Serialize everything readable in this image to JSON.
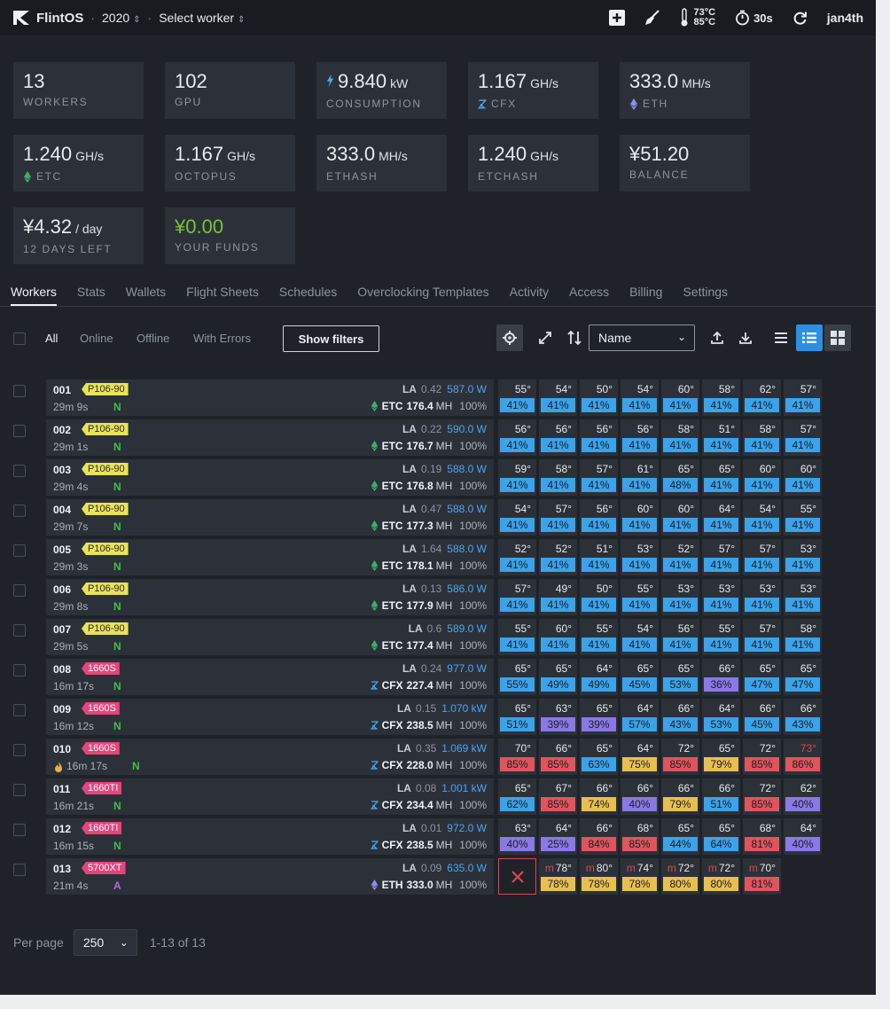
{
  "topbar": {
    "brand": "FlintOS",
    "farm": "2020",
    "worker_select": "Select worker",
    "temp_low": "73°C",
    "temp_high": "85°C",
    "timer": "30s",
    "user": "jan4th"
  },
  "stats": [
    [
      {
        "value": "13",
        "unit": "",
        "label": "WORKERS",
        "icon": ""
      },
      {
        "value": "102",
        "unit": "",
        "label": "GPU",
        "icon": ""
      },
      {
        "value": "9.840",
        "unit": "kW",
        "label": "CONSUMPTION",
        "icon": "lightning-icon"
      },
      {
        "value": "1.167",
        "unit": "GH/s",
        "label": "CFX",
        "icon": "cfx-icon"
      },
      {
        "value": "333.0",
        "unit": "MH/s",
        "label": "ETH",
        "icon": "eth-icon"
      }
    ],
    [
      {
        "value": "1.240",
        "unit": "GH/s",
        "label": "ETC",
        "icon": "etc-icon"
      },
      {
        "value": "1.167",
        "unit": "GH/s",
        "label": "OCTOPUS",
        "icon": ""
      },
      {
        "value": "333.0",
        "unit": "MH/s",
        "label": "ETHASH",
        "icon": ""
      },
      {
        "value": "1.240",
        "unit": "GH/s",
        "label": "ETCHASH",
        "icon": ""
      },
      {
        "value": "¥51.20",
        "unit": "",
        "label": "BALANCE",
        "icon": ""
      }
    ],
    [
      {
        "value": "¥4.32",
        "unit": "/ day",
        "label": "12 DAYS LEFT",
        "icon": ""
      },
      {
        "value": "¥0.00",
        "unit": "",
        "label": "YOUR FUNDS",
        "icon": "",
        "green": true
      }
    ]
  ],
  "tabs": [
    "Workers",
    "Stats",
    "Wallets",
    "Flight Sheets",
    "Schedules",
    "Overclocking Templates",
    "Activity",
    "Access",
    "Billing",
    "Settings"
  ],
  "filters": [
    "All",
    "Online",
    "Offline",
    "With Errors"
  ],
  "show_filters": "Show filters",
  "sort_select": "Name",
  "fan_colors": {
    "blue": "#3aa3ea",
    "purple": "#8a78e6",
    "red": "#e0545e",
    "yellow": "#e8c050"
  },
  "tag_colors": {
    "P106-90": "#e9e25a",
    "1660S": "#e8447c",
    "1660TI": "#e8447c",
    "5700XT": "#e8447c"
  },
  "workers": [
    {
      "id": "001",
      "tag": "P106-90",
      "uptime": "29m 9s",
      "net": "N",
      "la": "0.42",
      "power": "587.0 W",
      "coin": "ETC",
      "hashrate": "176.4",
      "unit": "MH",
      "share": "100%",
      "gpus": [
        [
          "55°",
          "41%",
          "blue"
        ],
        [
          "54°",
          "41%",
          "blue"
        ],
        [
          "50°",
          "41%",
          "blue"
        ],
        [
          "54°",
          "41%",
          "blue"
        ],
        [
          "60°",
          "41%",
          "blue"
        ],
        [
          "58°",
          "41%",
          "blue"
        ],
        [
          "62°",
          "41%",
          "blue"
        ],
        [
          "57°",
          "41%",
          "blue"
        ]
      ]
    },
    {
      "id": "002",
      "tag": "P106-90",
      "uptime": "29m 1s",
      "net": "N",
      "la": "0.22",
      "power": "590.0 W",
      "coin": "ETC",
      "hashrate": "176.7",
      "unit": "MH",
      "share": "100%",
      "gpus": [
        [
          "56°",
          "41%",
          "blue"
        ],
        [
          "56°",
          "41%",
          "blue"
        ],
        [
          "56°",
          "41%",
          "blue"
        ],
        [
          "56°",
          "41%",
          "blue"
        ],
        [
          "58°",
          "41%",
          "blue"
        ],
        [
          "51°",
          "41%",
          "blue"
        ],
        [
          "58°",
          "41%",
          "blue"
        ],
        [
          "57°",
          "41%",
          "blue"
        ]
      ]
    },
    {
      "id": "003",
      "tag": "P106-90",
      "uptime": "29m 4s",
      "net": "N",
      "la": "0.19",
      "power": "588.0 W",
      "coin": "ETC",
      "hashrate": "176.8",
      "unit": "MH",
      "share": "100%",
      "gpus": [
        [
          "59°",
          "41%",
          "blue"
        ],
        [
          "58°",
          "41%",
          "blue"
        ],
        [
          "57°",
          "41%",
          "blue"
        ],
        [
          "61°",
          "41%",
          "blue"
        ],
        [
          "65°",
          "48%",
          "blue"
        ],
        [
          "65°",
          "41%",
          "blue"
        ],
        [
          "60°",
          "41%",
          "blue"
        ],
        [
          "60°",
          "41%",
          "blue"
        ]
      ]
    },
    {
      "id": "004",
      "tag": "P106-90",
      "uptime": "29m 7s",
      "net": "N",
      "la": "0.47",
      "power": "588.0 W",
      "coin": "ETC",
      "hashrate": "177.3",
      "unit": "MH",
      "share": "100%",
      "gpus": [
        [
          "54°",
          "41%",
          "blue"
        ],
        [
          "57°",
          "41%",
          "blue"
        ],
        [
          "56°",
          "41%",
          "blue"
        ],
        [
          "60°",
          "41%",
          "blue"
        ],
        [
          "60°",
          "41%",
          "blue"
        ],
        [
          "64°",
          "41%",
          "blue"
        ],
        [
          "54°",
          "41%",
          "blue"
        ],
        [
          "55°",
          "41%",
          "blue"
        ]
      ]
    },
    {
      "id": "005",
      "tag": "P106-90",
      "uptime": "29m 3s",
      "net": "N",
      "la": "1.64",
      "power": "588.0 W",
      "coin": "ETC",
      "hashrate": "178.1",
      "unit": "MH",
      "share": "100%",
      "gpus": [
        [
          "52°",
          "41%",
          "blue"
        ],
        [
          "52°",
          "41%",
          "blue"
        ],
        [
          "51°",
          "41%",
          "blue"
        ],
        [
          "53°",
          "41%",
          "blue"
        ],
        [
          "52°",
          "41%",
          "blue"
        ],
        [
          "57°",
          "41%",
          "blue"
        ],
        [
          "57°",
          "41%",
          "blue"
        ],
        [
          "53°",
          "41%",
          "blue"
        ]
      ]
    },
    {
      "id": "006",
      "tag": "P106-90",
      "uptime": "29m 8s",
      "net": "N",
      "la": "0.13",
      "power": "586.0 W",
      "coin": "ETC",
      "hashrate": "177.9",
      "unit": "MH",
      "share": "100%",
      "gpus": [
        [
          "57°",
          "41%",
          "blue"
        ],
        [
          "49°",
          "41%",
          "blue"
        ],
        [
          "50°",
          "41%",
          "blue"
        ],
        [
          "55°",
          "41%",
          "blue"
        ],
        [
          "53°",
          "41%",
          "blue"
        ],
        [
          "53°",
          "41%",
          "blue"
        ],
        [
          "53°",
          "41%",
          "blue"
        ],
        [
          "53°",
          "41%",
          "blue"
        ]
      ]
    },
    {
      "id": "007",
      "tag": "P106-90",
      "uptime": "29m 5s",
      "net": "N",
      "la": "0.6",
      "power": "589.0 W",
      "coin": "ETC",
      "hashrate": "177.4",
      "unit": "MH",
      "share": "100%",
      "gpus": [
        [
          "55°",
          "41%",
          "blue"
        ],
        [
          "60°",
          "41%",
          "blue"
        ],
        [
          "55°",
          "41%",
          "blue"
        ],
        [
          "54°",
          "41%",
          "blue"
        ],
        [
          "56°",
          "41%",
          "blue"
        ],
        [
          "55°",
          "41%",
          "blue"
        ],
        [
          "57°",
          "41%",
          "blue"
        ],
        [
          "58°",
          "41%",
          "blue"
        ]
      ]
    },
    {
      "id": "008",
      "tag": "1660S",
      "uptime": "16m 17s",
      "net": "N",
      "la": "0.24",
      "power": "977.0 W",
      "coin": "CFX",
      "hashrate": "227.4",
      "unit": "MH",
      "share": "100%",
      "gpus": [
        [
          "65°",
          "55%",
          "blue"
        ],
        [
          "65°",
          "49%",
          "blue"
        ],
        [
          "64°",
          "49%",
          "blue"
        ],
        [
          "65°",
          "45%",
          "blue"
        ],
        [
          "65°",
          "53%",
          "blue"
        ],
        [
          "66°",
          "36%",
          "purple"
        ],
        [
          "65°",
          "47%",
          "blue"
        ],
        [
          "65°",
          "47%",
          "blue"
        ]
      ]
    },
    {
      "id": "009",
      "tag": "1660S",
      "uptime": "16m 12s",
      "net": "N",
      "la": "0.15",
      "power": "1.070 kW",
      "coin": "CFX",
      "hashrate": "238.5",
      "unit": "MH",
      "share": "100%",
      "gpus": [
        [
          "65°",
          "51%",
          "blue"
        ],
        [
          "63°",
          "39%",
          "purple"
        ],
        [
          "65°",
          "39%",
          "purple"
        ],
        [
          "64°",
          "57%",
          "blue"
        ],
        [
          "66°",
          "43%",
          "blue"
        ],
        [
          "64°",
          "53%",
          "blue"
        ],
        [
          "66°",
          "45%",
          "blue"
        ],
        [
          "66°",
          "43%",
          "blue"
        ]
      ]
    },
    {
      "id": "010",
      "tag": "1660S",
      "uptime": "16m 17s",
      "net": "N",
      "flame": true,
      "la": "0.35",
      "power": "1.069 kW",
      "coin": "CFX",
      "hashrate": "228.0",
      "unit": "MH",
      "share": "100%",
      "gpus": [
        [
          "70°",
          "85%",
          "red"
        ],
        [
          "66°",
          "85%",
          "red"
        ],
        [
          "65°",
          "63%",
          "blue"
        ],
        [
          "64°",
          "75%",
          "yellow"
        ],
        [
          "72°",
          "85%",
          "red"
        ],
        [
          "65°",
          "79%",
          "yellow"
        ],
        [
          "72°",
          "85%",
          "red"
        ],
        [
          "73°",
          "86%",
          "red",
          "hot"
        ]
      ]
    },
    {
      "id": "011",
      "tag": "1660TI",
      "uptime": "16m 21s",
      "net": "N",
      "la": "0.08",
      "power": "1.001 kW",
      "coin": "CFX",
      "hashrate": "234.4",
      "unit": "MH",
      "share": "100%",
      "gpus": [
        [
          "65°",
          "62%",
          "blue"
        ],
        [
          "67°",
          "85%",
          "red"
        ],
        [
          "66°",
          "74%",
          "yellow"
        ],
        [
          "66°",
          "40%",
          "purple"
        ],
        [
          "66°",
          "79%",
          "yellow"
        ],
        [
          "66°",
          "51%",
          "blue"
        ],
        [
          "72°",
          "85%",
          "red"
        ],
        [
          "62°",
          "40%",
          "purple"
        ]
      ]
    },
    {
      "id": "012",
      "tag": "1660TI",
      "uptime": "16m 15s",
      "net": "N",
      "la": "0.01",
      "power": "972.0 W",
      "coin": "CFX",
      "hashrate": "238.5",
      "unit": "MH",
      "share": "100%",
      "gpus": [
        [
          "63°",
          "40%",
          "purple"
        ],
        [
          "64°",
          "25%",
          "purple"
        ],
        [
          "66°",
          "84%",
          "red"
        ],
        [
          "68°",
          "85%",
          "red"
        ],
        [
          "65°",
          "44%",
          "blue"
        ],
        [
          "65°",
          "64%",
          "blue"
        ],
        [
          "68°",
          "81%",
          "red"
        ],
        [
          "64°",
          "40%",
          "purple"
        ]
      ]
    },
    {
      "id": "013",
      "tag": "5700XT",
      "uptime": "21m 4s",
      "net": "A",
      "la": "0.09",
      "power": "635.0 W",
      "coin": "ETH",
      "hashrate": "333.0",
      "unit": "MH",
      "share": "100%",
      "error_first": true,
      "gpus": [
        [
          "78°",
          "78%",
          "yellow",
          "m"
        ],
        [
          "80°",
          "78%",
          "yellow",
          "m"
        ],
        [
          "74°",
          "78%",
          "yellow",
          "m"
        ],
        [
          "72°",
          "80%",
          "yellow",
          "m"
        ],
        [
          "72°",
          "80%",
          "yellow",
          "m"
        ],
        [
          "70°",
          "81%",
          "red",
          "m"
        ]
      ]
    }
  ],
  "footer": {
    "per_page_label": "Per page",
    "per_page": "250",
    "range": "1-13 of 13"
  },
  "labels": {
    "la": "LA",
    "mem_mark": "m"
  }
}
